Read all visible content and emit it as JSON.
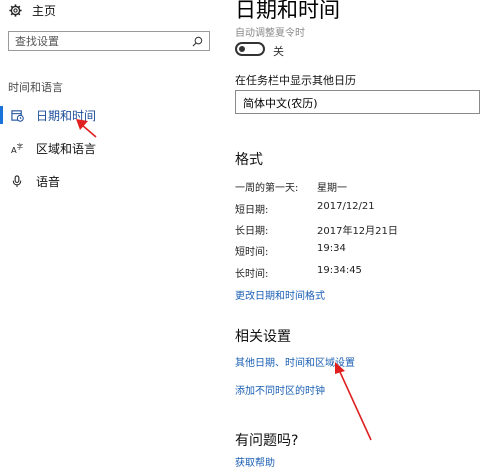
{
  "sidebar": {
    "home_label": "主页",
    "search_placeholder": "查找设置",
    "section_label": "时间和语言",
    "items": [
      {
        "label": "日期和时间",
        "icon": "calendar-clock-icon",
        "selected": true
      },
      {
        "label": "区域和语言",
        "icon": "region-language-icon",
        "selected": false
      },
      {
        "label": "语音",
        "icon": "microphone-icon",
        "selected": false
      }
    ]
  },
  "main": {
    "title": "日期和时间",
    "dst_label": "自动调整夏令时",
    "dst_state": "关",
    "extra_calendar_label": "在任务栏中显示其他日历",
    "extra_calendar_value": "简体中文(农历)",
    "format_heading": "格式",
    "formats": [
      {
        "key": "一周的第一天:",
        "value": "星期一"
      },
      {
        "key": "短日期:",
        "value": "2017/12/21"
      },
      {
        "key": "长日期:",
        "value": "2017年12月21日"
      },
      {
        "key": "短时间:",
        "value": "19:34"
      },
      {
        "key": "长时间:",
        "value": "19:34:45"
      }
    ],
    "change_format_link": "更改日期和时间格式",
    "related_heading": "相关设置",
    "related_links": [
      "其他日期、时间和区域设置",
      "添加不同时区的时钟"
    ],
    "help_heading": "有问题吗?",
    "help_link": "获取帮助"
  },
  "colors": {
    "accent": "#1a73d8",
    "link": "#1a5fb4",
    "annotation_arrow": "#e02020"
  }
}
